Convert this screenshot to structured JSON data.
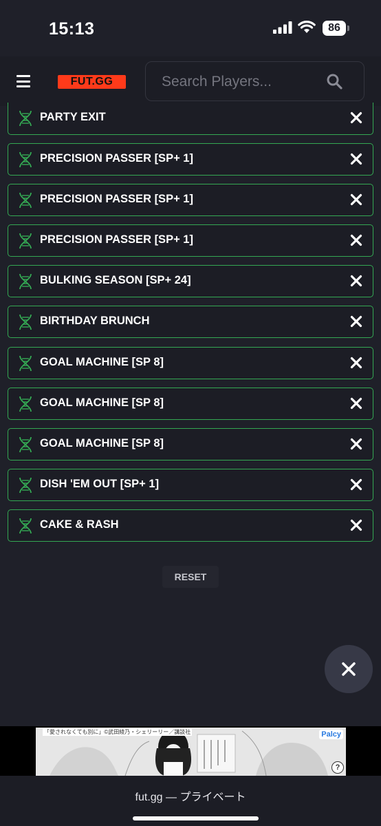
{
  "status": {
    "time": "15:13",
    "battery": "86"
  },
  "header": {
    "logo": "FUT.GG",
    "search_placeholder": "Search Players..."
  },
  "items": [
    {
      "label": "PARTY EXIT"
    },
    {
      "label": "PRECISION PASSER [SP+ 1]"
    },
    {
      "label": "PRECISION PASSER [SP+ 1]"
    },
    {
      "label": "PRECISION PASSER [SP+ 1]"
    },
    {
      "label": "BULKING SEASON [SP+ 24]"
    },
    {
      "label": "BIRTHDAY BRUNCH"
    },
    {
      "label": "GOAL MACHINE [SP 8]"
    },
    {
      "label": "GOAL MACHINE [SP 8]"
    },
    {
      "label": "GOAL MACHINE [SP 8]"
    },
    {
      "label": "DISH 'EM OUT [SP+ 1]"
    },
    {
      "label": "CAKE & RASH"
    }
  ],
  "reset_label": "RESET",
  "ad": {
    "caption": "「愛されなくても別に」©武田綾乃・シェリーリー／講談社",
    "badge": "Palcy",
    "help": "?"
  },
  "browser": {
    "url": "fut.gg — プライベート"
  },
  "colors": {
    "accent": "#34a853",
    "logo": "#ff3a1a",
    "background": "#1f2029"
  }
}
